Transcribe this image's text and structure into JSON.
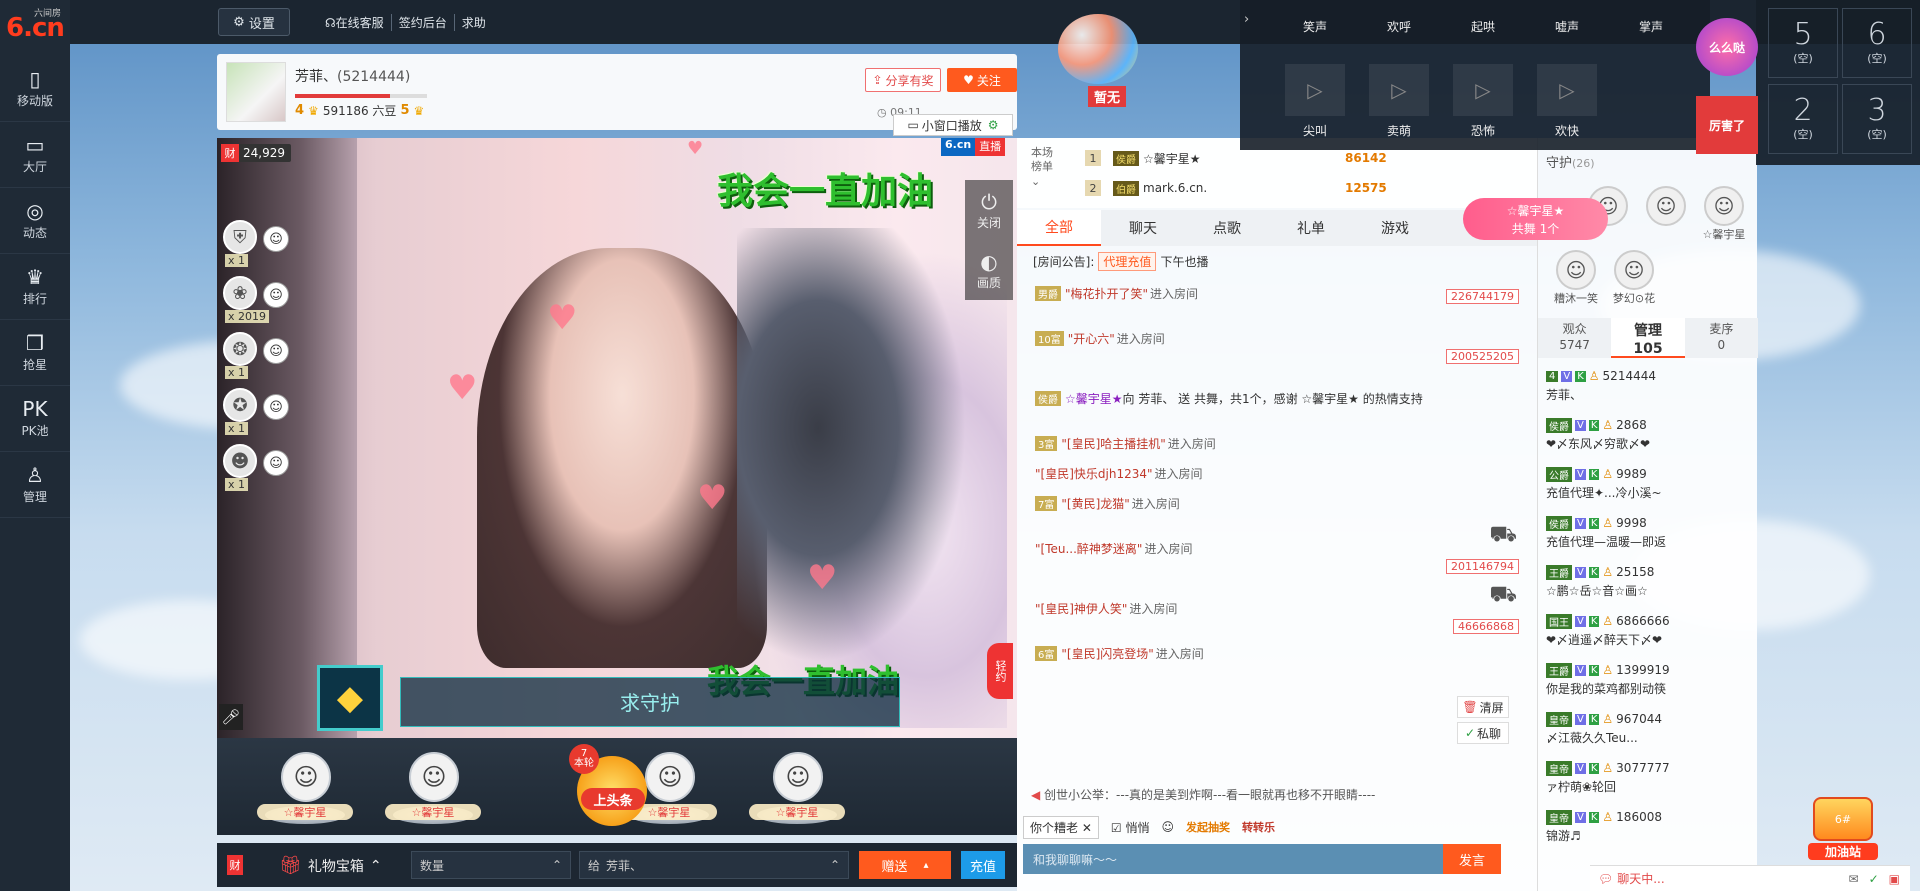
{
  "site": {
    "logo_text": "6.cn",
    "logo_small": "六间房"
  },
  "nav": [
    {
      "label": "移动版",
      "icon": "phone-icon",
      "glyph": "▯"
    },
    {
      "label": "大厅",
      "icon": "tv-icon",
      "glyph": "▭"
    },
    {
      "label": "动态",
      "icon": "compass-icon",
      "glyph": "◎"
    },
    {
      "label": "排行",
      "icon": "crown-icon",
      "glyph": "♛"
    },
    {
      "label": "抢星",
      "icon": "gift-icon",
      "glyph": "❒"
    },
    {
      "label": "PK池",
      "icon": "pk-icon",
      "glyph": "PK"
    },
    {
      "label": "管理",
      "icon": "person-icon",
      "glyph": "♙"
    }
  ],
  "topbar": {
    "settings": "设置",
    "links": [
      "在线客服",
      "签约后台",
      "求助"
    ]
  },
  "anchor": {
    "name": "芳菲、",
    "uid": "(5214444)",
    "level": "4",
    "beans": "591186 六豆",
    "level2": "5",
    "progress": 0.72,
    "share": "分享有奖",
    "follow": "关注",
    "time": "09:11"
  },
  "video": {
    "wealth": "24,929",
    "mini_play": "小窗口播放",
    "brand": "6.cn",
    "live": "直播",
    "slogan_top": "我会一直加油",
    "slogan_bottom": "我会一直加油",
    "guard_text": "求守护",
    "controls": [
      {
        "label": "关闭",
        "icon": "power-icon",
        "glyph": "⏻"
      },
      {
        "label": "画质",
        "icon": "quality-icon",
        "glyph": "◐"
      }
    ],
    "gift_tab": "轻约",
    "gift_rank": [
      {
        "count": "x 1",
        "glyph": "⛨"
      },
      {
        "count": "x 2019",
        "glyph": "❀"
      },
      {
        "count": "x 1",
        "glyph": "❂"
      },
      {
        "count": "x 1",
        "glyph": "✪"
      },
      {
        "count": "x 1",
        "glyph": "☻"
      }
    ]
  },
  "seats": [
    {
      "name": "☆馨宇星"
    },
    {
      "name": "☆馨宇星"
    },
    {
      "name": "☆馨宇星"
    },
    {
      "name": "☆馨宇星"
    }
  ],
  "headline": {
    "label": "上头条",
    "round": "7",
    "round_text": "本轮"
  },
  "giftbar": {
    "wealth": "财",
    "gift_box": "礼物宝箱",
    "qty_placeholder": "数量",
    "to_prefix": "给",
    "to_name": "芳菲、",
    "send": "赠送",
    "recharge": "充值"
  },
  "balloon": {
    "label": "暂无"
  },
  "rank": {
    "label": "本场榜单",
    "rows": [
      {
        "no": "1",
        "badge": "侯爵",
        "name": "☆馨宇星★",
        "score": "86142"
      },
      {
        "no": "2",
        "badge": "伯爵",
        "name": "mark.6.cn.",
        "score": "12575"
      }
    ]
  },
  "chat": {
    "tabs": [
      "全部",
      "聊天",
      "点歌",
      "礼单",
      "游戏"
    ],
    "announce_label": "[房间公告]:",
    "announce_tag": "代理充值",
    "announce_text": "下午也播",
    "messages": [
      {
        "type": "enter",
        "tag": "男爵",
        "name": "\"梅花扑开了笑\"",
        "text": "进入房间",
        "uid": "226744179",
        "tall": false,
        "tank": false
      },
      {
        "type": "enter",
        "tag": "10富",
        "name": "\"开心六\"",
        "text": "进入房间",
        "uid": "200525205",
        "tall": true,
        "tank": false
      },
      {
        "type": "gift",
        "tag": "侯爵",
        "name": "☆馨宇星★",
        "text": "向 芳菲、 送 共舞，共1个，感谢 ☆馨宇星★ 的热情支持",
        "uid": "",
        "tall": true,
        "tank": false
      },
      {
        "type": "enter",
        "tag": "3富",
        "name": "\"[皇民]哈主播挂机\"",
        "text": "进入房间",
        "uid": "",
        "tall": false,
        "tank": false
      },
      {
        "type": "enter",
        "tag": "",
        "name": "\"[皇民]快乐djh1234\"",
        "text": "进入房间",
        "uid": "",
        "tall": false,
        "tank": false
      },
      {
        "type": "enter",
        "tag": "7富",
        "name": "\"[黄民]龙猫\"",
        "text": "进入房间",
        "uid": "",
        "tall": false,
        "tank": false
      },
      {
        "type": "enter",
        "tag": "",
        "name": "\"[Teu...醉神梦迷离\"",
        "text": "进入房间",
        "uid": "201146794",
        "tall": true,
        "tank": true
      },
      {
        "type": "enter",
        "tag": "",
        "name": "\"[皇民]神伊人笑\"",
        "text": "进入房间",
        "uid": "46666868",
        "tall": true,
        "tank": true
      },
      {
        "type": "enter",
        "tag": "6富",
        "name": "\"[皇民]闪亮登场\"",
        "text": "进入房间",
        "uid": "",
        "tall": false,
        "tank": false
      }
    ],
    "clear": "清屏",
    "private": "私聊",
    "bulletin": "创世小公举：---真的是美到炸啊---看一眼就再也移不开眼睛----",
    "target": "你个糟老",
    "quiet": "悄悄",
    "tool1": "发起抽奖",
    "tool2": "转转乐",
    "input_placeholder": "和我聊聊嘛～～",
    "send": "发言"
  },
  "users": {
    "guard_title": "守护",
    "guard_count": "(26)",
    "guards": [
      {
        "name": "",
        "glyph": "☺"
      },
      {
        "name": "",
        "glyph": "☺"
      },
      {
        "name": "☆馨宇星",
        "glyph": "☺"
      },
      {
        "name": "糟沐一笑",
        "glyph": "☺"
      },
      {
        "name": "梦幻⊙花",
        "glyph": "☺"
      }
    ],
    "tabs": [
      {
        "label": "观众",
        "count": "5747"
      },
      {
        "label": "管理",
        "count": "105"
      },
      {
        "label": "麦序",
        "count": "0"
      }
    ],
    "list": [
      {
        "id": "5214444",
        "name": "芳菲、",
        "rank": "4"
      },
      {
        "id": "2868",
        "name": "❤〆东风〆穷歌〆❤",
        "rank": "侯爵"
      },
      {
        "id": "9989",
        "name": "充值代理✦...冷小溪~",
        "rank": "公爵"
      },
      {
        "id": "9998",
        "name": "充值代理—温暖—即返",
        "rank": "侯爵"
      },
      {
        "id": "25158",
        "name": "☆鹏☆岳☆音☆画☆",
        "rank": "王爵"
      },
      {
        "id": "6866666",
        "name": "❤〆逍遥〆醉天下〆❤",
        "rank": "国王"
      },
      {
        "id": "1399919",
        "name": "你是我的菜鸡都别动筷",
        "rank": "王爵"
      },
      {
        "id": "967044",
        "name": "〆江薇久久Teu...",
        "rank": "皇帝"
      },
      {
        "id": "3077777",
        "name": "ァ柠萌❀轮回",
        "rank": "皇帝"
      },
      {
        "id": "186008",
        "name": "锦游♬",
        "rank": "皇帝"
      }
    ]
  },
  "sound": {
    "row1": [
      "笑声",
      "欢呼",
      "起哄",
      "嘘声",
      "掌声"
    ],
    "row2": [
      "尖叫",
      "卖萌",
      "恐怖",
      "欢快"
    ],
    "slots": [
      {
        "n": "5",
        "s": "(空)"
      },
      {
        "n": "6",
        "s": "(空)"
      },
      {
        "n": "2",
        "s": "(空)"
      },
      {
        "n": "3",
        "s": "(空)"
      }
    ],
    "sticker1": "么么哒",
    "sticker2": "厉害了"
  },
  "vip": {
    "line1": "☆馨宇星★",
    "line2": "共舞 1个"
  },
  "fuel": {
    "label": "加油站",
    "tag": "6#"
  },
  "bottom_bar": {
    "chatting": "聊天中..."
  }
}
